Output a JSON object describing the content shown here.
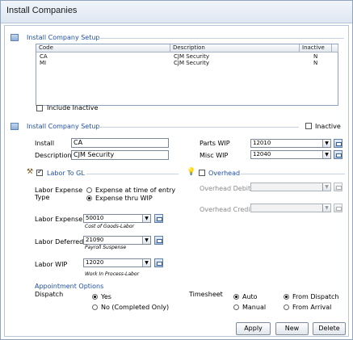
{
  "window": {
    "title": "Install Companies"
  },
  "grid_section": {
    "title": "Install Company Setup"
  },
  "grid": {
    "columns": [
      "Code",
      "Description",
      "Inactive"
    ],
    "rows": [
      {
        "code": "CA",
        "description": "CJM Security",
        "inactive": "N"
      },
      {
        "code": "MI",
        "description": "CJM Security",
        "inactive": "N"
      }
    ],
    "include_inactive_label": "Include Inactive"
  },
  "setup_section": {
    "title": "Install Company Setup",
    "inactive_label": "Inactive",
    "install_label": "Install",
    "install_value": "CA",
    "description_label": "Description",
    "description_value": "CJM Security",
    "parts_wip_label": "Parts WIP",
    "parts_wip_value": "12010",
    "misc_wip_label": "Misc WIP",
    "misc_wip_value": "12040"
  },
  "labor_gl": {
    "title": "Labor To GL",
    "expense_type_label_1": "Labor Expense",
    "expense_type_label_2": "Type",
    "option_entry": "Expense at time of entry",
    "option_wip": "Expense thru WIP",
    "labor_expense_label": "Labor Expense",
    "labor_expense_value": "50010",
    "labor_expense_desc": "Cost of Goods-Labor",
    "labor_deferred_label": "Labor Deferred",
    "labor_deferred_value": "21090",
    "labor_deferred_desc": "Payroll Suspense",
    "labor_wip_label": "Labor WIP",
    "labor_wip_value": "12020",
    "labor_wip_desc": "Work In Process-Labor"
  },
  "overhead": {
    "title": "Overhead",
    "debit_label": "Overhead Debit",
    "credit_label": "Overhead Credit"
  },
  "appointment": {
    "title": "Appointment Options",
    "dispatch_label": "Dispatch",
    "dispatch_yes": "Yes",
    "dispatch_no": "No (Completed Only)",
    "timesheet_label": "Timesheet",
    "ts_auto": "Auto",
    "ts_manual": "Manual",
    "ts_from_dispatch": "From Dispatch",
    "ts_from_arrival": "From Arrival"
  },
  "buttons": {
    "apply": "Apply",
    "new": "New",
    "delete": "Delete"
  },
  "colors": {
    "section_title": "#1f4fa6",
    "window_border": "#8fa3bd"
  },
  "icons": [
    "grid-section-icon",
    "setup-section-icon",
    "hammer-icon",
    "lightbulb-icon",
    "lookup-icon",
    "dropdown-arrow-icon"
  ]
}
